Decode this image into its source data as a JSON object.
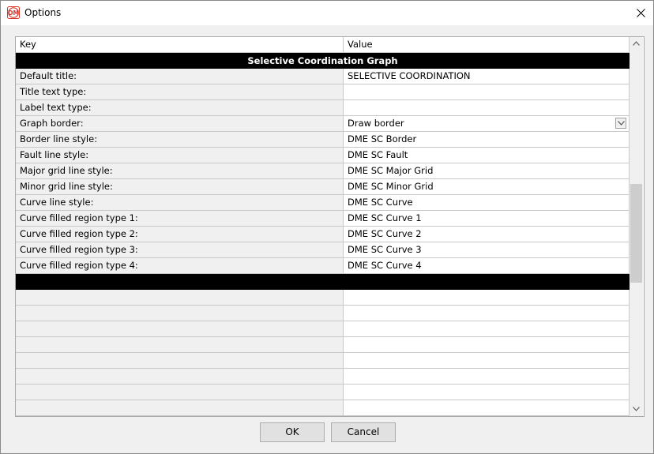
{
  "window": {
    "title": "Options",
    "icon_letters": "OM"
  },
  "grid": {
    "columns": {
      "key": "Key",
      "value": "Value"
    },
    "section_title": "Selective Coordination Graph",
    "rows": [
      {
        "key": "Default title:",
        "value": "SELECTIVE COORDINATION"
      },
      {
        "key": "Title text type:",
        "value": ""
      },
      {
        "key": "Label text type:",
        "value": ""
      },
      {
        "key": "Graph border:",
        "value": "Draw border",
        "dropdown": true
      },
      {
        "key": "Border line style:",
        "value": "DME SC Border"
      },
      {
        "key": "Fault line style:",
        "value": "DME SC Fault"
      },
      {
        "key": "Major grid line style:",
        "value": "DME SC Major Grid"
      },
      {
        "key": "Minor grid line style:",
        "value": "DME SC Minor Grid"
      },
      {
        "key": "Curve line style:",
        "value": "DME SC Curve"
      },
      {
        "key": "Curve filled region type 1:",
        "value": "DME SC Curve 1"
      },
      {
        "key": "Curve filled region type 2:",
        "value": "DME SC Curve 2"
      },
      {
        "key": "Curve filled region type 3:",
        "value": "DME SC Curve 3"
      },
      {
        "key": "Curve filled region type 4:",
        "value": "DME SC Curve 4"
      }
    ]
  },
  "buttons": {
    "ok": "OK",
    "cancel": "Cancel"
  },
  "colors": {
    "section_bg": "#000000",
    "key_bg": "#f0f0f0",
    "value_bg": "#ffffff",
    "icon_red": "#d9342b"
  }
}
